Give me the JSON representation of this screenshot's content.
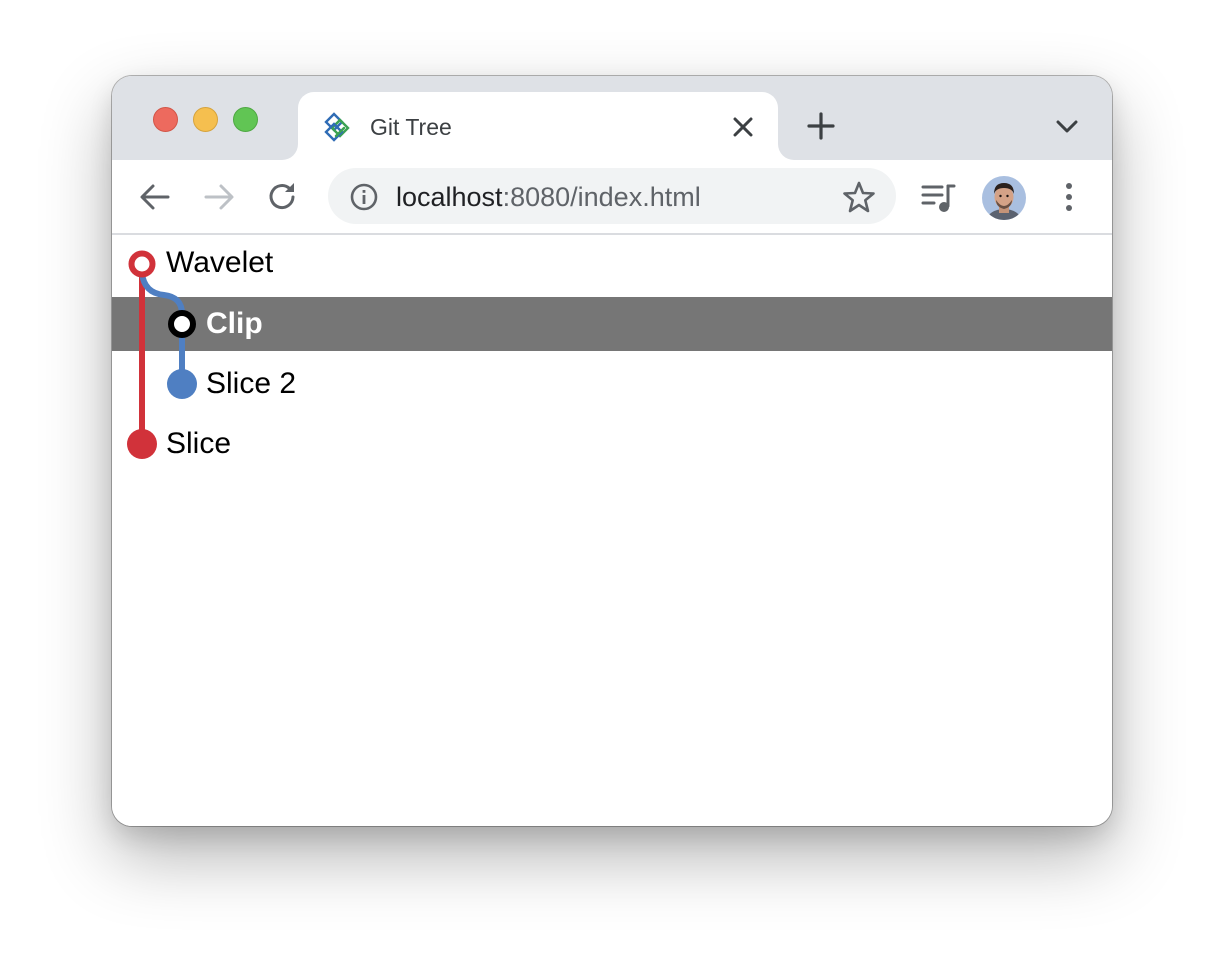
{
  "window": {
    "controls": [
      "close",
      "minimize",
      "maximize"
    ]
  },
  "tab": {
    "title": "Git Tree",
    "favicon": "git-tree-logo-icon"
  },
  "toolbar": {
    "url_host": "localhost",
    "url_rest": ":8080/index.html"
  },
  "tree": {
    "items": [
      {
        "label": "Wavelet",
        "level": 0,
        "branch_color": "#d1323a",
        "node": "hollow",
        "selected": false
      },
      {
        "label": "Clip",
        "level": 1,
        "branch_color": "#4f7fc2",
        "node": "hollow-black",
        "selected": true
      },
      {
        "label": "Slice 2",
        "level": 1,
        "branch_color": "#4f7fc2",
        "node": "filled",
        "selected": false
      },
      {
        "label": "Slice",
        "level": 0,
        "branch_color": "#d1323a",
        "node": "filled",
        "selected": false
      }
    ],
    "selected_color": "#767676"
  }
}
